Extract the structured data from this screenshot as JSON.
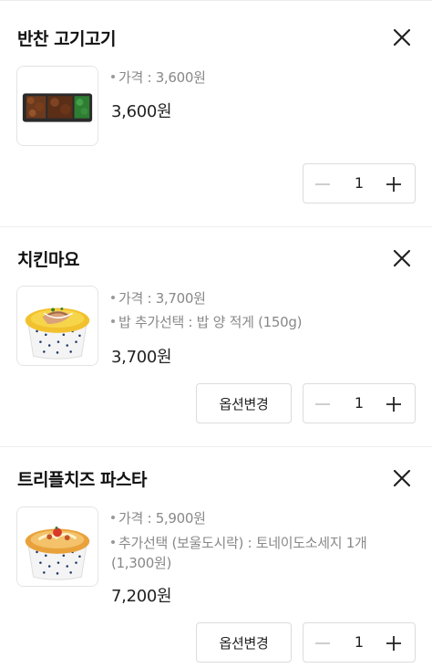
{
  "items": [
    {
      "title": "반찬 고기고기",
      "options": [
        "가격 : 3,600원"
      ],
      "price": "3,600원",
      "quantity": "1",
      "thumb": "bulgogi-side-dish-image"
    },
    {
      "title": "치킨마요",
      "options": [
        "가격 : 3,700원",
        "밥 추가선택 : 밥 양 적게 (150g)"
      ],
      "price": "3,700원",
      "quantity": "1",
      "option_button": "옵션변경",
      "thumb": "chicken-mayo-bowl-image"
    },
    {
      "title": "트리플치즈 파스타",
      "options": [
        "가격 : 5,900원",
        "추가선택 (보울도시락) : 토네이도소세지 1개",
        "(1,300원)"
      ],
      "price": "7,200원",
      "quantity": "1",
      "option_button": "옵션변경",
      "thumb": "triple-cheese-pasta-bowl-image"
    }
  ],
  "icons": {
    "close": "close-icon",
    "minus": "minus-icon",
    "plus": "plus-icon"
  },
  "colors": {
    "text": "#222222",
    "muted": "#888888",
    "border": "#dcdcdc",
    "disabled_icon": "#c8c8c8"
  }
}
